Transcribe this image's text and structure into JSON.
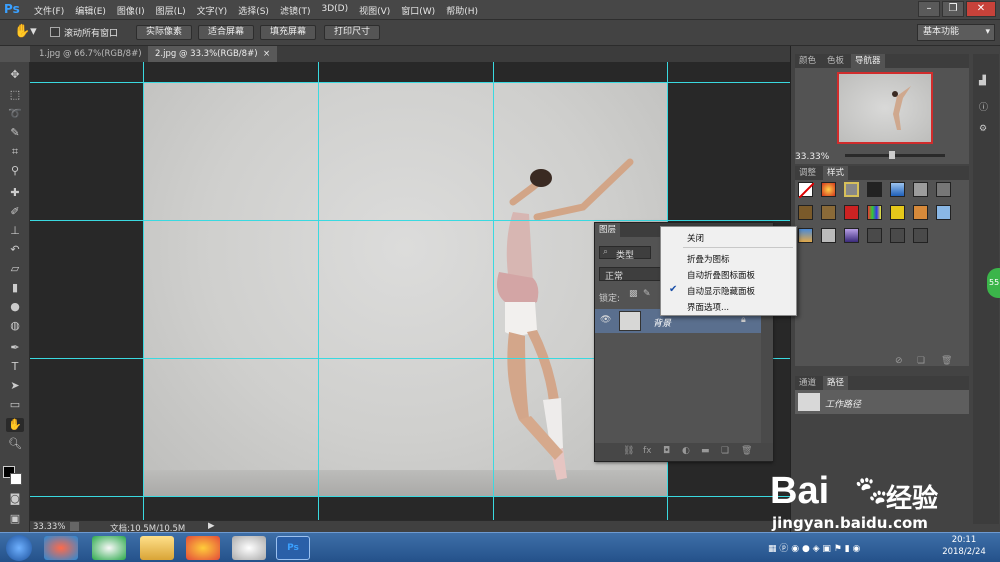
{
  "app": {
    "logo": "Ps"
  },
  "menu": [
    "文件(F)",
    "编辑(E)",
    "图像(I)",
    "图层(L)",
    "文字(Y)",
    "选择(S)",
    "滤镜(T)",
    "3D(D)",
    "视图(V)",
    "窗口(W)",
    "帮助(H)"
  ],
  "options": {
    "scroll_all": "滚动所有窗口",
    "actual_pixels": "实际像素",
    "fit_screen": "适合屏幕",
    "fill_screen": "填充屏幕",
    "print_size": "打印尺寸",
    "workspace": "基本功能"
  },
  "tabs": [
    {
      "label": "1.jpg @ 66.7%(RGB/8#)",
      "close": "×"
    },
    {
      "label": "2.jpg @ 33.3%(RGB/8#)",
      "close": "×"
    }
  ],
  "status": {
    "zoom": "33.33%",
    "doc": "文档:10.5M/10.5M"
  },
  "navigator": {
    "tabs": [
      "颜色",
      "色板",
      "导航器"
    ],
    "zoom": "33.33%"
  },
  "adjust": {
    "tabs": [
      "调整",
      "样式"
    ]
  },
  "channels": {
    "tabs": [
      "通道",
      "路径"
    ],
    "path_name": "工作路径"
  },
  "layers": {
    "title": "图层",
    "filter": "类型",
    "blend": "正常",
    "lock_label": "锁定:",
    "layer_name": "背景"
  },
  "context_menu": {
    "items": [
      "关闭",
      "折叠为图标",
      "自动折叠图标面板",
      "自动显示隐藏面板",
      "界面选项..."
    ],
    "checked_item": "自动显示隐藏面板"
  },
  "taskbar": {
    "time": "20:11",
    "date": "2018/2/24"
  },
  "watermark": {
    "brand": "Bai",
    "brand2": "经验",
    "url": "jingyan.baidu.com"
  },
  "side_badge": "55"
}
